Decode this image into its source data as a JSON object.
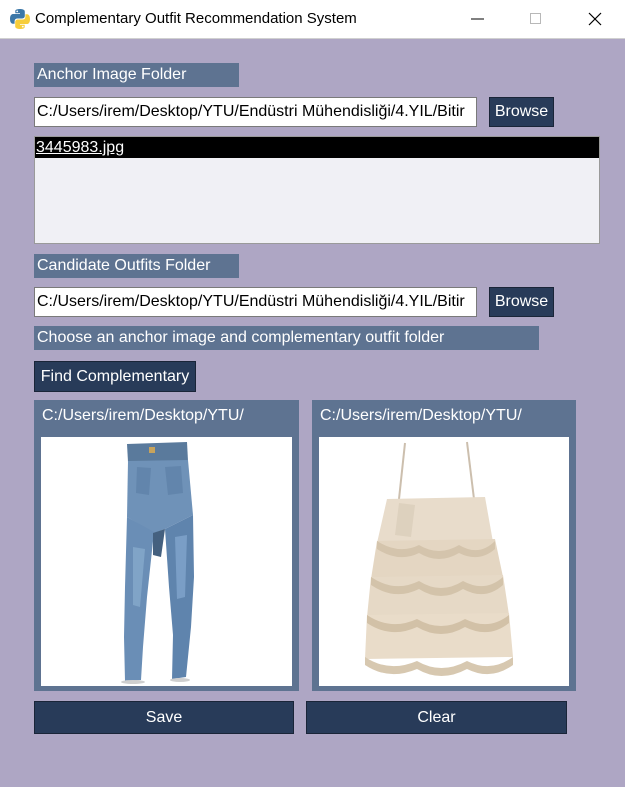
{
  "window": {
    "title": "Complementary Outfit Recommendation System"
  },
  "anchor": {
    "label": "Anchor Image Folder",
    "path": "C:/Users/irem/Desktop/YTU/Endüstri Mühendisliği/4.YIL/Bitir",
    "browse_label": "Browse",
    "files": [
      "3445983.jpg"
    ]
  },
  "candidates": {
    "label": "Candidate Outfits Folder",
    "path": "C:/Users/irem/Desktop/YTU/Endüstri Mühendisliği/4.YIL/Bitir",
    "browse_label": "Browse"
  },
  "status": {
    "text": "Choose an anchor image and complementary outfit folder"
  },
  "actions": {
    "find_label": "Find Complementary",
    "save_label": "Save",
    "clear_label": "Clear"
  },
  "results": {
    "anchor_path": "C:/Users/irem/Desktop/YTU/",
    "anchor_image": "jeans-image",
    "complement_path": "C:/Users/irem/Desktop/YTU/",
    "complement_image": "ruffled-top-image"
  },
  "colors": {
    "background": "#aea6c4",
    "label_bg": "#5e7391",
    "button_bg": "#283b59",
    "selection_bg": "#000000"
  }
}
